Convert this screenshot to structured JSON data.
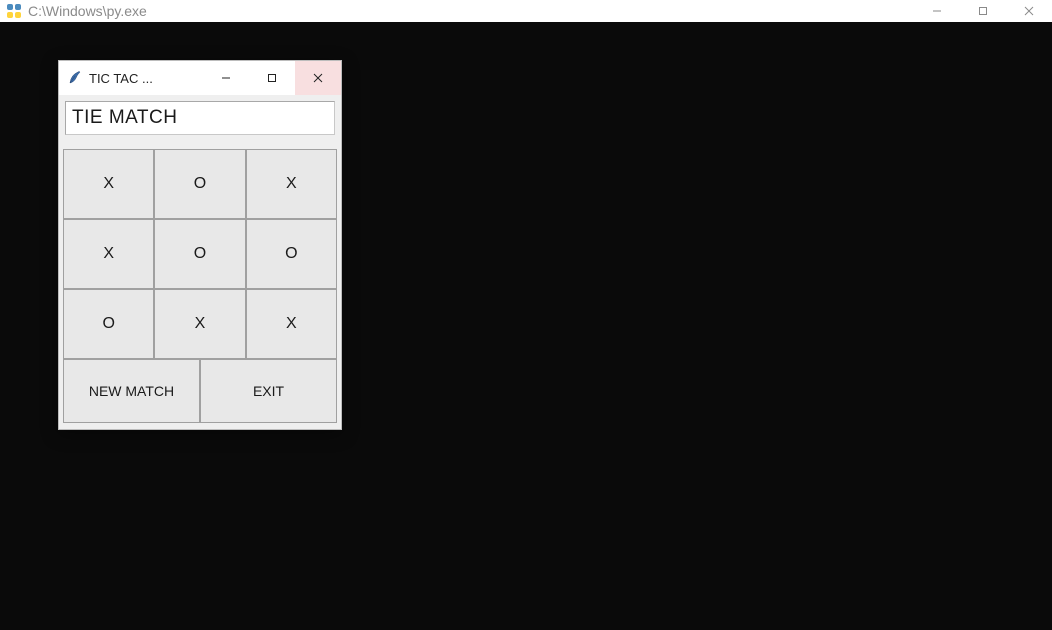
{
  "outer_window": {
    "title": "C:\\Windows\\py.exe"
  },
  "inner_window": {
    "title": "TIC TAC ...",
    "status_text": "TIE MATCH",
    "board": {
      "row0": {
        "c0": "X",
        "c1": "O",
        "c2": "X"
      },
      "row1": {
        "c0": "X",
        "c1": "O",
        "c2": "O"
      },
      "row2": {
        "c0": "O",
        "c1": "X",
        "c2": "X"
      }
    },
    "buttons": {
      "new_match": "NEW MATCH",
      "exit": "EXIT"
    }
  }
}
